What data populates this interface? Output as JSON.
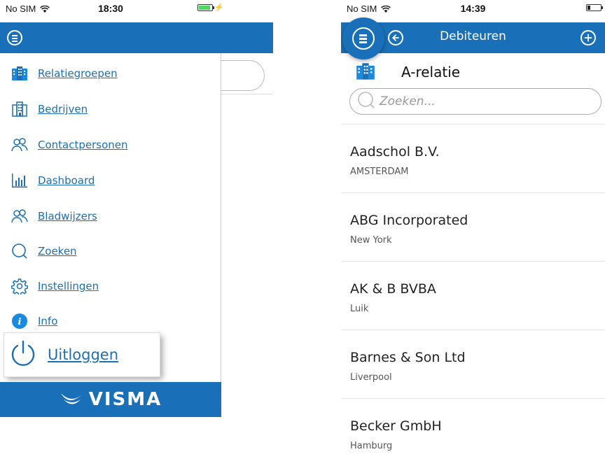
{
  "left_phone": {
    "status": {
      "carrier": "No SIM",
      "time": "18:30",
      "battery_level": 0.9
    },
    "menu_items": [
      {
        "icon": "building-group-icon",
        "label": "Relatiegroepen"
      },
      {
        "icon": "building-icon",
        "label": "Bedrijven"
      },
      {
        "icon": "people-icon",
        "label": "Contactpersonen"
      },
      {
        "icon": "bar-chart-icon",
        "label": "Dashboard"
      },
      {
        "icon": "people-icon",
        "label": "Bladwijzers"
      },
      {
        "icon": "search-icon",
        "label": "Zoeken"
      },
      {
        "icon": "gear-icon",
        "label": "Instellingen"
      },
      {
        "icon": "info-icon",
        "label": "Info"
      }
    ],
    "logout": {
      "icon": "power-icon",
      "label": "Uitloggen"
    },
    "brand": "VISMA"
  },
  "right_phone": {
    "status": {
      "carrier": "No SIM",
      "time": "14:39",
      "battery_level": 0.2
    },
    "nav": {
      "title": "Debiteuren"
    },
    "group": "A-relatie",
    "search": {
      "placeholder": "Zoeken..."
    },
    "customers": [
      {
        "name": "Aadschol B.V.",
        "city": "AMSTERDAM"
      },
      {
        "name": "ABG Incorporated",
        "city": "New York"
      },
      {
        "name": "AK & B BVBA",
        "city": "Luik"
      },
      {
        "name": "Barnes & Son Ltd",
        "city": "Liverpool"
      },
      {
        "name": "Becker GmbH",
        "city": "Hamburg"
      }
    ]
  },
  "colors": {
    "brand_blue": "#1a70b8",
    "link_blue": "#1d6fb3",
    "info_blue": "#1a8ae0"
  }
}
